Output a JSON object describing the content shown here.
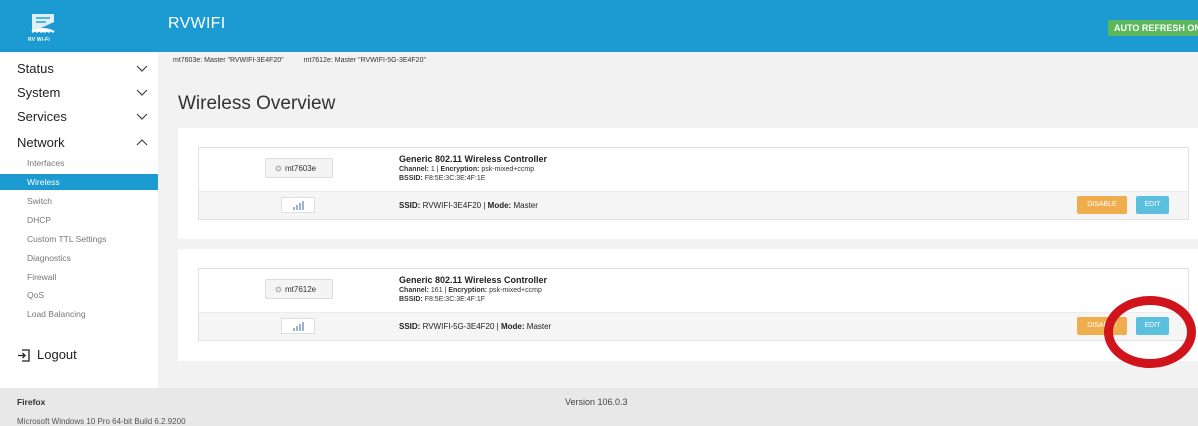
{
  "header": {
    "logo_text": "RV Wi-Fi",
    "brand": "RVWIFI",
    "auto_refresh": "AUTO REFRESH ON"
  },
  "sidebar": {
    "categories": [
      {
        "label": "Status",
        "expanded": false
      },
      {
        "label": "System",
        "expanded": false
      },
      {
        "label": "Services",
        "expanded": false
      },
      {
        "label": "Network",
        "expanded": true
      }
    ],
    "network_items": [
      {
        "label": "Interfaces",
        "active": false
      },
      {
        "label": "Wireless",
        "active": true
      },
      {
        "label": "Switch",
        "active": false
      },
      {
        "label": "DHCP",
        "active": false
      },
      {
        "label": "Custom TTL Settings",
        "active": false
      },
      {
        "label": "Diagnostics",
        "active": false
      },
      {
        "label": "Firewall",
        "active": false
      },
      {
        "label": "QoS",
        "active": false
      },
      {
        "label": "Load Balancing",
        "active": false
      }
    ],
    "logout": "Logout"
  },
  "radio_bar": [
    "mt7603e: Master \"RVWIFI-3E4F20\"",
    "mt7612e: Master \"RVWIFI-5G-3E4F20\""
  ],
  "page_title": "Wireless Overview",
  "devices": [
    {
      "name": "mt7603e",
      "title": "Generic 802.11 Wireless Controller",
      "channel_label": "Channel:",
      "channel": "1",
      "encryption_label": "Encryption:",
      "encryption": "psk-mixed+ccmp",
      "bssid_label": "BSSID:",
      "bssid": "F8:5E:3C:3E:4F:1E",
      "ssid_label": "SSID:",
      "ssid": "RVWIFI-3E4F20",
      "mode_label": "Mode:",
      "mode": "Master",
      "disable_label": "DISABLE",
      "edit_label": "EDIT"
    },
    {
      "name": "mt7612e",
      "title": "Generic 802.11 Wireless Controller",
      "channel_label": "Channel:",
      "channel": "161",
      "encryption_label": "Encryption:",
      "encryption": "psk-mixed+ccmp",
      "bssid_label": "BSSID:",
      "bssid": "F8:5E:3C:3E:4F:1F",
      "ssid_label": "SSID:",
      "ssid": "RVWIFI-5G-3E4F20",
      "mode_label": "Mode:",
      "mode": "Master",
      "disable_label": "DISABLE",
      "edit_label": "EDIT"
    }
  ],
  "footer": {
    "browser": "Firefox",
    "version": "Version 106.0.3",
    "os": "Microsoft Windows 10 Pro 64-bit Build 6.2.9200"
  },
  "colors": {
    "header": "#1b9bd1",
    "auto_refresh": "#5cb85c",
    "disable": "#f0ad4e",
    "edit": "#5bc0de",
    "annotation": "#d0141b"
  }
}
